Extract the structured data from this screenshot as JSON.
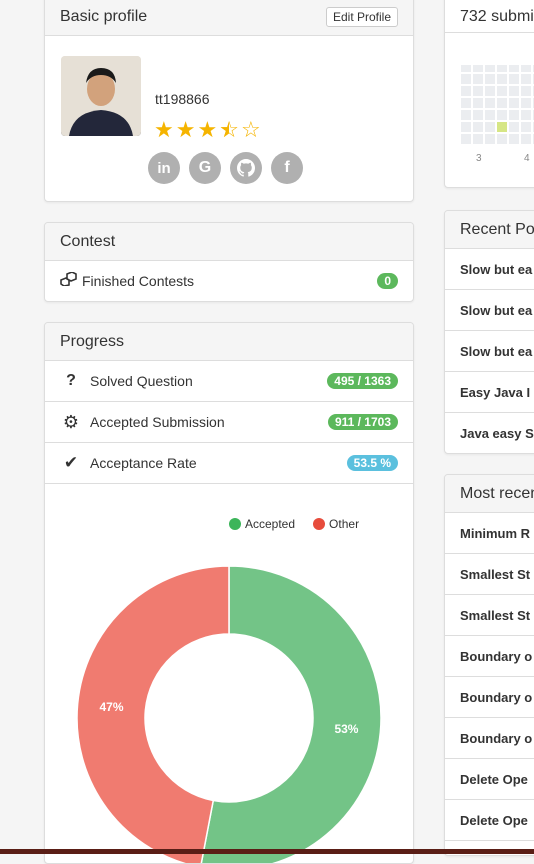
{
  "basic_profile": {
    "title": "Basic profile",
    "edit_button": "Edit Profile",
    "username": "tt198866",
    "rating_stars": 3.5,
    "social_icons": [
      "linkedin-icon",
      "google-icon",
      "github-icon",
      "facebook-icon"
    ]
  },
  "contest": {
    "title": "Contest",
    "finished_label": "Finished Contests",
    "finished_count": "0"
  },
  "progress": {
    "title": "Progress",
    "rows": [
      {
        "icon": "question-icon",
        "label": "Solved Question",
        "value": "495 / 1363",
        "color": "#5cb85c"
      },
      {
        "icon": "gear-icon",
        "label": "Accepted Submission",
        "value": "911 / 1703",
        "color": "#5cb85c"
      },
      {
        "icon": "check-icon",
        "label": "Acceptance Rate",
        "value": "53.5 %",
        "color": "#5bc0de"
      }
    ]
  },
  "chart_data": {
    "type": "pie",
    "categories": [
      "Accepted",
      "Other"
    ],
    "values": [
      53,
      47
    ],
    "slice_labels": [
      "53%",
      "47%"
    ],
    "colors": [
      "#73c487",
      "#f07b70"
    ],
    "legend_colors": [
      "#3cb55a",
      "#e74c3c"
    ],
    "legend_position": "top-right"
  },
  "submissions": {
    "title": "732 submi",
    "heatmap_labels": [
      "3",
      "4"
    ]
  },
  "recent_posts": {
    "title": "Recent Po",
    "items": [
      "Slow but ea",
      "Slow but ea",
      "Slow but ea",
      "Easy Java I",
      "Java easy S"
    ]
  },
  "most_recent": {
    "title": "Most recen",
    "items": [
      "Minimum R",
      "Smallest St",
      "Smallest St",
      "Boundary o",
      "Boundary o",
      "Boundary o",
      "Delete Ope",
      "Delete Ope"
    ]
  }
}
